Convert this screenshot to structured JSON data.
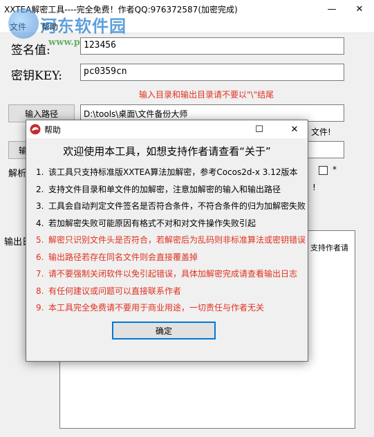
{
  "window": {
    "title": "XXTEA解密工具----完全免费！作者QQ:976372587(加密完成)",
    "minimize_glyph": "—",
    "close_glyph": "✕"
  },
  "menu": {
    "items": [
      "文件",
      "帮助"
    ]
  },
  "watermark": {
    "name": "河东软件园",
    "url": "www.pc0359.cn"
  },
  "form": {
    "sign_label": "签名值:",
    "sign_value": "123456",
    "key_label": "密钥KEY:",
    "key_value": "pc0359cn",
    "path_note": "输入目录和输出目录请不要以\"\\\"结尾",
    "input_path_button": "输入路径",
    "input_path_value": "D:\\tools\\桌面\\文件备份大师",
    "output_path_button_fragment": "输",
    "file_note_fragment": "文件!",
    "parse_label_fragment": "解析",
    "checkbox_star": "*",
    "excl_fragment": "!",
    "output_label_fragment": "输出日",
    "log_fragment": "支持作者请"
  },
  "dialog": {
    "title": "帮助",
    "maximize_glyph": "☐",
    "close_glyph": "✕",
    "heading": "欢迎使用本工具，如想支持作者请查看“关于”",
    "items": [
      {
        "num": "1.",
        "text": "该工具只支持标准版XXTEA算法加解密，参考Cocos2d-x 3.12版本"
      },
      {
        "num": "2.",
        "text": "支持文件目录和单文件的加解密，注意加解密的输入和输出路径"
      },
      {
        "num": "3.",
        "text": "工具会自动判定文件签名是否符合条件，不符合条件的归为加解密失败"
      },
      {
        "num": "4.",
        "text": "若加解密失败可能原因有格式不对和对文件操作失败引起"
      },
      {
        "num": "5.",
        "text": "解密只识别文件头是否符合，若解密后为乱码则非标准算法或密钥错误"
      },
      {
        "num": "6.",
        "text": "输出路径若存在同名文件则会直接覆盖掉"
      },
      {
        "num": "7.",
        "text": "请不要强制关闭软件以免引起错误，具体加解密完成请查看输出日志"
      },
      {
        "num": "8.",
        "text": "有任何建议或问题可以直接联系作者"
      },
      {
        "num": "9.",
        "text": "本工具完全免费请不要用于商业用途，一切责任与作者无关"
      }
    ],
    "ok_button": "确定"
  },
  "colors": {
    "warning_red": "#e0311f",
    "focus_blue": "#0078d7"
  }
}
